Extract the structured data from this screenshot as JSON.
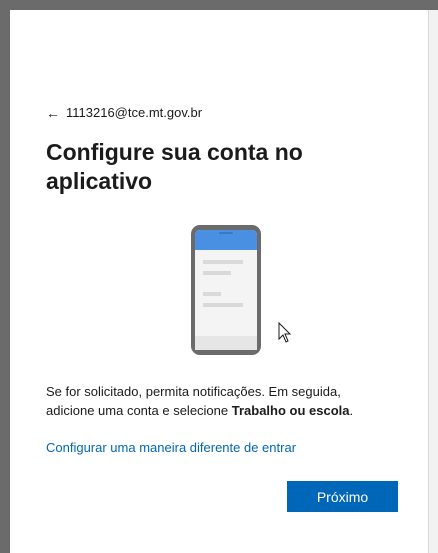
{
  "account": {
    "back_arrow": "←",
    "email": "1113216@tce.mt.gov.br"
  },
  "page": {
    "title": "Configure sua conta no aplicativo"
  },
  "instructions": {
    "text_before_bold": "Se for solicitado, permita notificações. Em seguida, adicione uma conta e selecione ",
    "bold_text": "Trabalho ou escola",
    "text_after_bold": "."
  },
  "links": {
    "alternate_signin": "Configurar uma maneira diferente de entrar"
  },
  "buttons": {
    "next_label": "Próximo"
  },
  "colors": {
    "accent": "#0067b8",
    "phone_screen_header": "#4a90e2",
    "phone_body": "#6b6b6b"
  },
  "icons": {
    "back": "left-arrow-icon",
    "phone": "phone-illustration",
    "cursor": "mouse-pointer-icon"
  }
}
